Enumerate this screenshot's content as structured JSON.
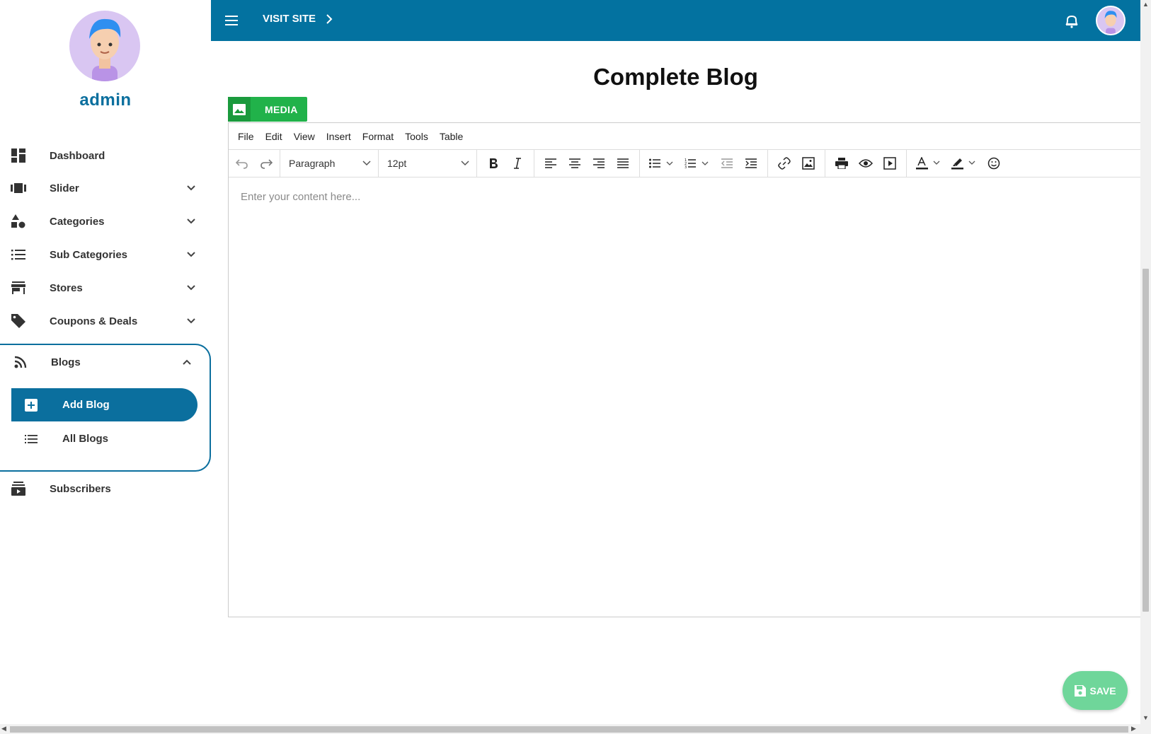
{
  "sidebar": {
    "user_name": "admin",
    "items": [
      {
        "label": "Dashboard",
        "icon": "dashboard-icon"
      },
      {
        "label": "Slider",
        "icon": "slider-icon"
      },
      {
        "label": "Categories",
        "icon": "categories-icon"
      },
      {
        "label": "Sub Categories",
        "icon": "list-icon"
      },
      {
        "label": "Stores",
        "icon": "store-icon"
      },
      {
        "label": "Coupons & Deals",
        "icon": "tag-icon"
      },
      {
        "label": "Blogs",
        "icon": "rss-icon"
      },
      {
        "label": "Subscribers",
        "icon": "subscriptions-icon"
      }
    ],
    "blogs_sub": [
      {
        "label": "Add Blog",
        "icon": "add-box-icon",
        "active": true
      },
      {
        "label": "All Blogs",
        "icon": "list-icon",
        "active": false
      }
    ]
  },
  "topbar": {
    "visit_site": "VISIT SITE"
  },
  "main": {
    "title": "Complete Blog",
    "media_button": "MEDIA",
    "save_button": "SAVE"
  },
  "editor": {
    "menu": [
      "File",
      "Edit",
      "View",
      "Insert",
      "Format",
      "Tools",
      "Table"
    ],
    "block_format": "Paragraph",
    "font_size": "12pt",
    "placeholder": "Enter your content here..."
  },
  "colors": {
    "primary": "#0372a0",
    "accent_green": "#21b24a",
    "save_green": "#6fd69a"
  }
}
